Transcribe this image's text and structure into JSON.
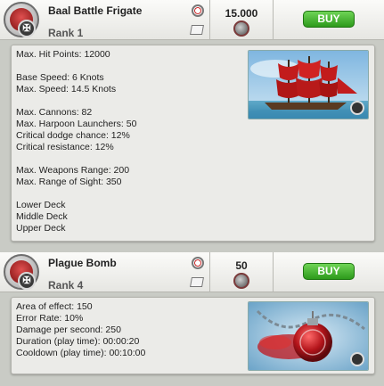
{
  "items": [
    {
      "title": "Baal Battle Frigate",
      "rank": "Rank 1",
      "price": "15.000",
      "buy_label": "BUY",
      "image_icon": "red-sailed-frigate-image",
      "stats": [
        "Max. Hit Points: 12000",
        "",
        "Base Speed: 6 Knots",
        "Max. Speed: 14.5 Knots",
        "",
        "Max. Cannons: 82",
        "Max. Harpoon Launchers: 50",
        "Critical dodge chance: 12%",
        "Critical resistance: 12%",
        "",
        "Max. Weapons Range: 200",
        "Max. Range of Sight: 350",
        "",
        "Lower Deck",
        "Middle Deck",
        "Upper Deck"
      ]
    },
    {
      "title": "Plague Bomb",
      "rank": "Rank 4",
      "price": "50",
      "buy_label": "BUY",
      "image_icon": "plague-bomb-image",
      "stats": [
        "Area of effect: 150",
        "Error Rate: 10%",
        "Damage per second: 250",
        "Duration (play time): 00:00:20",
        "Cooldown (play time): 00:10:00"
      ]
    }
  ],
  "colors": {
    "buy_button": "#3cae25",
    "sail_red": "#c21c1c",
    "panel_bg": "#ebebe8"
  }
}
